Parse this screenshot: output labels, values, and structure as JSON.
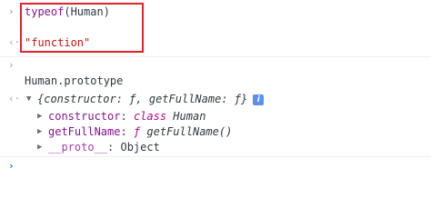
{
  "console": {
    "entry1": {
      "prompt_icon": "chevron-right-icon",
      "prompt_glyph": "›",
      "input_fn": "typeof",
      "input_arg": "(Human)",
      "result_glyph": "‹·",
      "result": "\"function\""
    },
    "entry2": {
      "prompt_glyph": "›",
      "input": "Human.prototype",
      "result_glyph": "‹·",
      "summary_open": "{",
      "summary_k1": "constructor",
      "summary_v1": "ƒ",
      "summary_k2": "getFullName",
      "summary_v2": "ƒ",
      "summary_close": "}",
      "info_label": "i",
      "props": [
        {
          "key": "constructor",
          "value_kw": "class",
          "value": "Human"
        },
        {
          "key": "getFullName",
          "value_kw": "ƒ",
          "value": "getFullName()"
        },
        {
          "key": "__proto__",
          "value_kw": "",
          "value": "Object"
        }
      ]
    },
    "prompt_glyph": "›"
  },
  "colors": {
    "highlight_box": "#e4212b",
    "string": "#c41a16",
    "property": "#881391",
    "prompt": "#1a73e8"
  }
}
